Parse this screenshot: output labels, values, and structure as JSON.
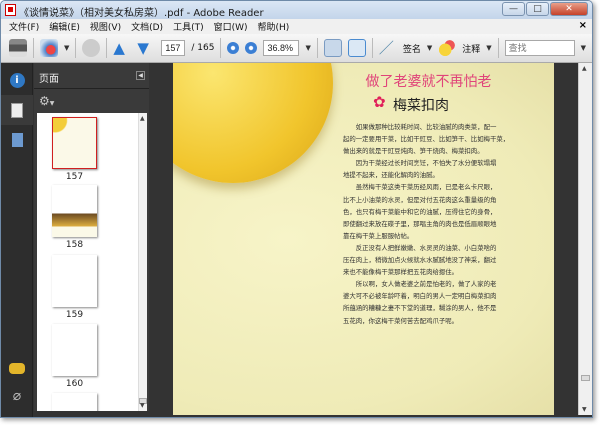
{
  "window": {
    "title": "《谈情说菜》（相对美女私房菜）.pdf - Adobe Reader",
    "minimize": "—",
    "restore": "□",
    "close": "✕"
  },
  "menu": [
    "文件(F)",
    "编辑(E)",
    "视图(V)",
    "文档(D)",
    "工具(T)",
    "窗口(W)",
    "帮助(H)"
  ],
  "menu_close": "×",
  "toolbar": {
    "page_current": "157",
    "page_total": "/ 165",
    "zoom": "36.8%",
    "sign_label": "签名",
    "comment_label": "注释",
    "search_placeholder": "查找"
  },
  "panel": {
    "title": "页面",
    "thumbnails": [
      {
        "page": "157"
      },
      {
        "page": "158"
      },
      {
        "page": "159"
      },
      {
        "page": "160"
      }
    ]
  },
  "document": {
    "title": "做了老婆就不再怕老",
    "subtitle": "梅菜扣肉",
    "lines": [
      "　　如果做那种比较耗时间、比较油腻的肉类菜，配一",
      "起的一定要用干菜，比如干豇豆、比如笋干、比如梅干菜，",
      "做出来的就是干豇豆炖肉、笋干烧肉、梅菜扣肉。",
      "　　因为干菜经过长时间烹饪，不怕失了水分便软塌塌",
      "地提不起来，还能化解肉的油腻。",
      "　　虽然梅干菜这类干菜历经风雨，已是老么卡尺眼，",
      "比不上小油菜的水灵，但是对付五花肉这么重量级的角",
      "色，也只有梅干菜能中和它的油腻，压得住它的身骨，",
      "即使翻过来放在碟子里，那唱主角的肉也是低眉顺眼地",
      "靠在梅干菜上服服帖帖。",
      "　　反正没有人把鲜嫩嫩、水灵灵的油菜、小白菜啥的",
      "压在肉上，稍微加点火候就水水腻腻地没了神采，翻过",
      "来也不能像梅干菜那样把五花肉给摁住。",
      "　　所以啊，女人做老婆之前是怕老的，做了人家的老",
      "婆大可不必被年龄吓着，明白的男人一定明白梅菜扣肉",
      "所蕴涵的糟糠之妻不下堂的道理，糊涂的男人，他不是",
      "五花肉，你这梅干菜何苦去配鸡爪子呢。"
    ]
  }
}
